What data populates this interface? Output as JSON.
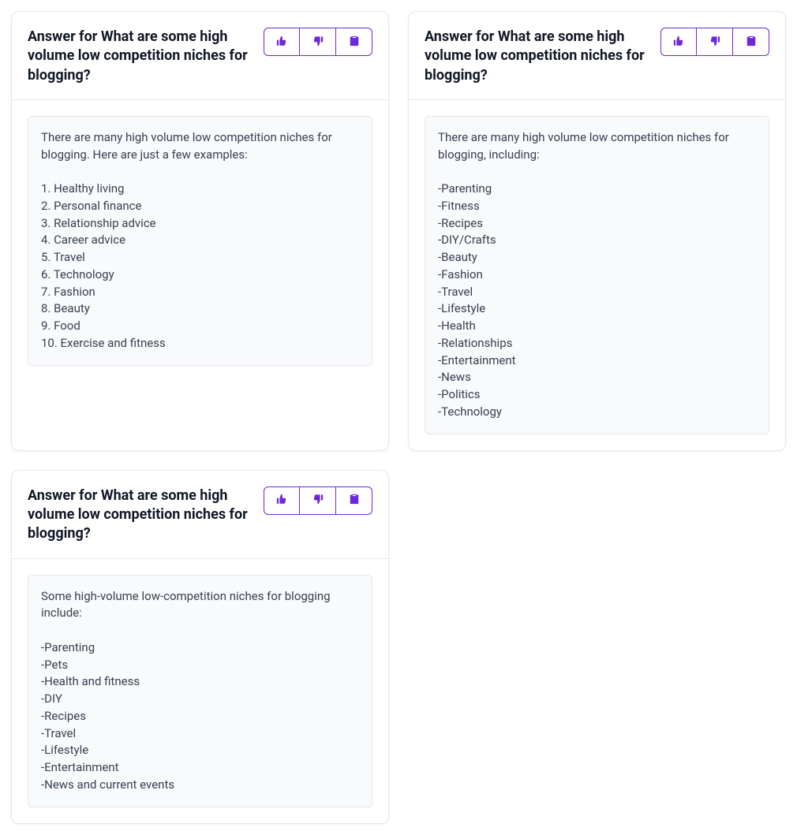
{
  "cards": [
    {
      "title": "Answer for What are some high volume low competition niches for blogging?",
      "content": "There are many high volume low competition niches for blogging. Here are just a few examples:\n\n1. Healthy living\n2. Personal finance\n3. Relationship advice\n4. Career advice\n5. Travel\n6. Technology\n7. Fashion\n8. Beauty\n9. Food\n10. Exercise and fitness"
    },
    {
      "title": "Answer for What are some high volume low competition niches for blogging?",
      "content": "There are many high volume low competition niches for blogging, including:\n\n-Parenting\n-Fitness\n-Recipes\n-DIY/Crafts\n-Beauty\n-Fashion\n-Travel\n-Lifestyle\n-Health\n-Relationships\n-Entertainment\n-News\n-Politics\n-Technology"
    },
    {
      "title": "Answer for What are some high volume low competition niches for blogging?",
      "content": "Some high-volume low-competition niches for blogging include:\n\n-Parenting\n-Pets\n-Health and fitness\n-DIY\n-Recipes\n-Travel\n-Lifestyle\n-Entertainment\n-News and current events"
    }
  ],
  "colors": {
    "accent": "#6d28d9"
  }
}
